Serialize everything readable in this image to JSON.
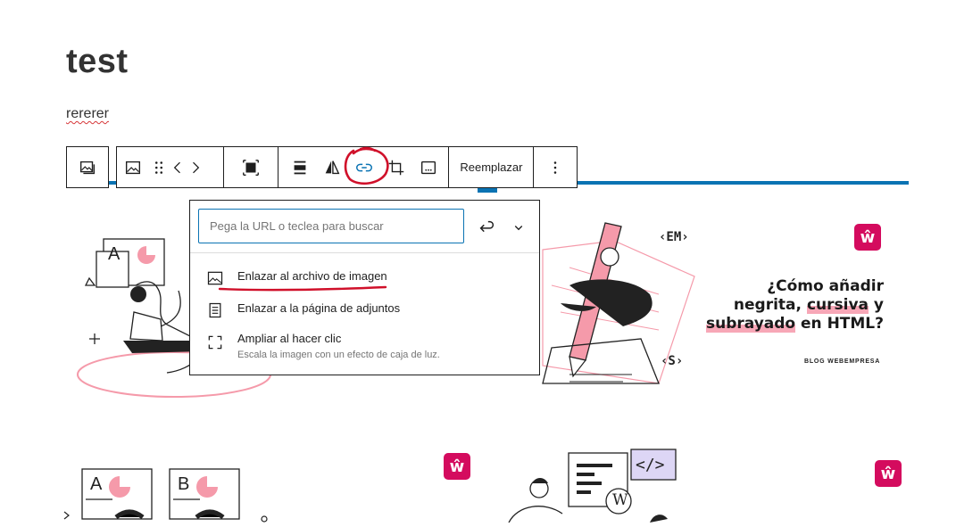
{
  "post": {
    "title": "test",
    "paragraph": "rererer"
  },
  "toolbar": {
    "replace_label": "Reemplazar"
  },
  "link_popover": {
    "search_placeholder": "Pega la URL o teclea para buscar",
    "options": [
      {
        "label": "Enlazar al archivo de imagen",
        "icon": "image-icon"
      },
      {
        "label": "Enlazar a la página de adjuntos",
        "icon": "page-icon"
      },
      {
        "label": "Ampliar al hacer clic",
        "description": "Escala la imagen con un efecto de caja de luz.",
        "icon": "fullscreen-icon"
      }
    ]
  },
  "gallery": {
    "card_headline_1": "¿Cómo añadir",
    "card_headline_2a": "negrita",
    "card_headline_2b": ", ",
    "card_headline_2c": "cursiva",
    "card_headline_2d": " y",
    "card_headline_3a": "subrayado",
    "card_headline_3b": " en HTML?",
    "card_tag": "BLOG WEBEMPRESA",
    "tag_em": "‹EM›",
    "tag_s": "‹S›",
    "badge": "ŵ",
    "letter_a": "A",
    "letter_b": "B",
    "code_tag": "</>",
    "wp_letter": "W"
  },
  "colors": {
    "accent_blue": "#0a73b3",
    "brand_pink": "#d40b5e",
    "annotation_red": "#d0102a"
  }
}
